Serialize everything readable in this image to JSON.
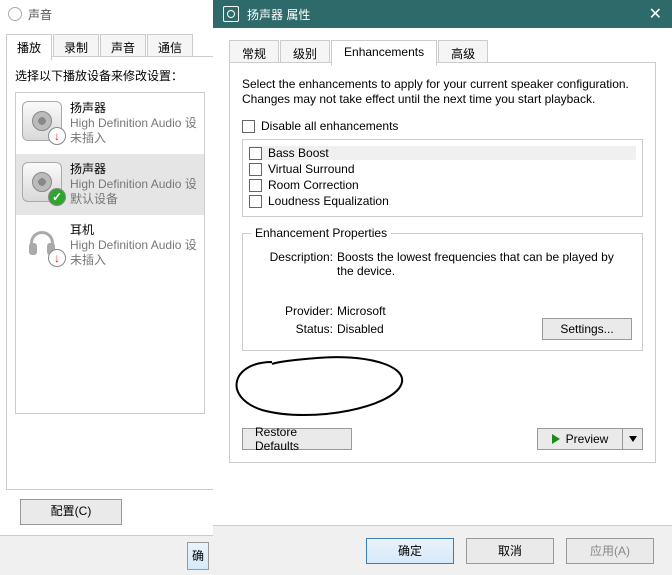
{
  "sound_window": {
    "title": "声音",
    "tabs": [
      "播放",
      "录制",
      "声音",
      "通信"
    ],
    "instruction": "选择以下播放设备来修改设置：",
    "devices": [
      {
        "name": "扬声器",
        "driver": "High Definition Audio 设",
        "state": "未插入",
        "badge": "down"
      },
      {
        "name": "扬声器",
        "driver": "High Definition Audio 设",
        "state": "默认设备",
        "badge": "ok"
      },
      {
        "name": "耳机",
        "driver": "High Definition Audio 设",
        "state": "未插入",
        "badge": "down"
      }
    ],
    "configure_btn": "配置(C)",
    "cutoff_ok": "确"
  },
  "props_window": {
    "title": "扬声器 属性",
    "tabs": [
      "常规",
      "级别",
      "Enhancements",
      "高级"
    ],
    "active_tab": 2,
    "description": "Select the enhancements to apply for your current speaker configuration. Changes may not take effect until the next time you start playback.",
    "disable_all": "Disable all enhancements",
    "enhancements": [
      "Bass Boost",
      "Virtual Surround",
      "Room Correction",
      "Loudness Equalization"
    ],
    "group_title": "Enhancement Properties",
    "description_label": "Description:",
    "description_value": "Boosts the lowest frequencies that can be played by the device.",
    "provider_label": "Provider:",
    "provider_value": "Microsoft",
    "status_label": "Status:",
    "status_value": "Disabled",
    "settings_btn": "Settings...",
    "restore_btn": "Restore Defaults",
    "preview_btn": "Preview",
    "footer": {
      "ok": "确定",
      "cancel": "取消",
      "apply": "应用(A)"
    }
  }
}
